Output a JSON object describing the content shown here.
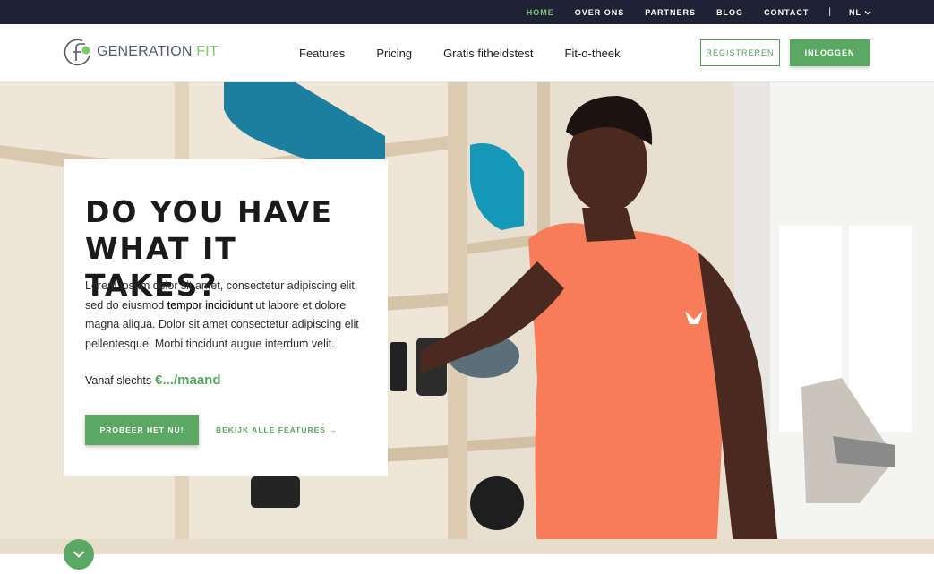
{
  "topbar": {
    "items": [
      {
        "label": "HOME",
        "active": true
      },
      {
        "label": "OVER ONS"
      },
      {
        "label": "PARTNERS"
      },
      {
        "label": "BLOG"
      },
      {
        "label": "CONTACT"
      }
    ],
    "separator": "|",
    "language": "NL"
  },
  "brand": {
    "name_part1": "GENERATION",
    "name_part2": "FIT"
  },
  "nav": {
    "items": [
      "Features",
      "Pricing",
      "Gratis fitheidstest",
      "Fit-o-theek"
    ],
    "register_label": "REGISTREREN",
    "login_label": "INLOGGEN"
  },
  "hero": {
    "title_line1": "DO YOU HAVE",
    "title_line2": "WHAT IT TAKES?",
    "body_part1": "Lorem ipsum dolor sit amet, consectetur adipiscing elit, sed do eiusmod ",
    "body_bold": "tempor incididunt",
    "body_part2": " ut labore et dolore magna aliqua. Dolor sit amet consectetur adipiscing elit pellentesque. Morbi tincidunt augue interdum velit.",
    "price_prefix": "Vanaf slechts",
    "price_value": "€.../maand",
    "cta_label": "PROBEER HET NU!",
    "features_link": "BEKIJK ALLE FEATURES",
    "features_arrow": "→"
  },
  "colors": {
    "topbar_bg": "#1f2235",
    "accent": "#5aa863",
    "accent_light": "#7dc96f"
  },
  "icons": {
    "language_dropdown": "chevron-down-icon",
    "scroll_down": "chevron-down-icon",
    "logo": "generation-fit-logo-icon"
  }
}
